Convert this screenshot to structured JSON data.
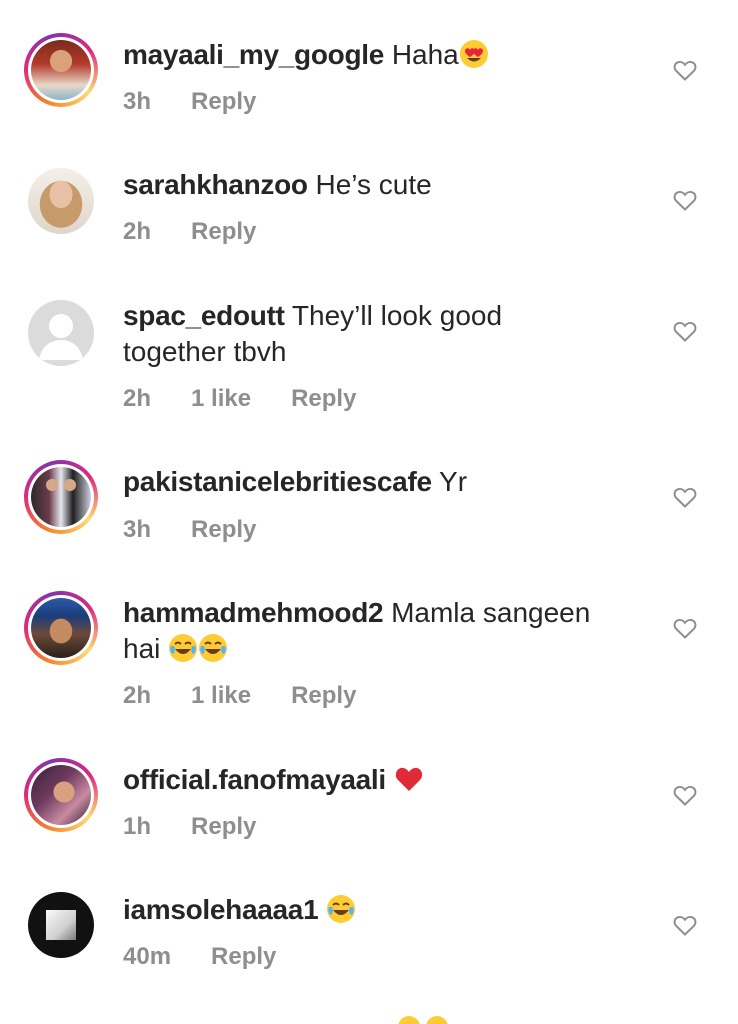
{
  "comments": [
    {
      "username": "mayaali_my_google",
      "text": "Haha",
      "time": "3h",
      "likes": "",
      "reply": "Reply",
      "emoji": "heart-eyes"
    },
    {
      "username": "sarahkhanzoo",
      "text": "He’s cute",
      "time": "2h",
      "likes": "",
      "reply": "Reply",
      "emoji": ""
    },
    {
      "username": "spac_edoutt",
      "text": "They’ll look good",
      "text2": "together tbvh",
      "time": "2h",
      "likes": "1 like",
      "reply": "Reply",
      "emoji": ""
    },
    {
      "username": "pakistanicelebritiescafe",
      "text": "Yr",
      "time": "3h",
      "likes": "",
      "reply": "Reply",
      "emoji": ""
    },
    {
      "username": "hammadmehmood2",
      "text": "Mamla sangeen",
      "text2": "hai",
      "time": "2h",
      "likes": "1 like",
      "reply": "Reply",
      "emoji": "tears-of-joy x2"
    },
    {
      "username": "official.fanofmayaali",
      "text": "",
      "time": "1h",
      "likes": "",
      "reply": "Reply",
      "emoji": "red-heart"
    },
    {
      "username": "iamsolehaaaa1",
      "text": "",
      "time": "40m",
      "likes": "",
      "reply": "Reply",
      "emoji": "tears-of-joy"
    }
  ]
}
